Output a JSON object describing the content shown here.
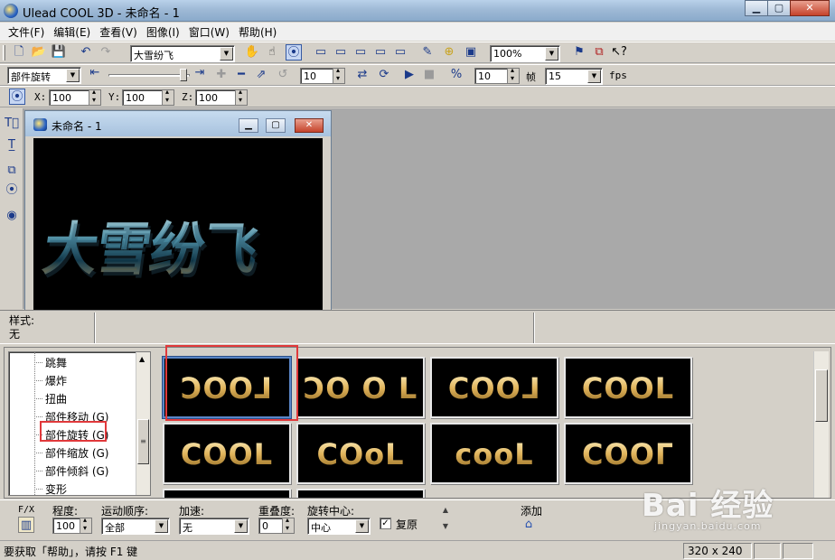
{
  "window": {
    "title": "Ulead COOL 3D - 未命名 - 1",
    "min_glyph": "▁",
    "max_glyph": "▢",
    "close_glyph": "✕"
  },
  "menu": [
    "文件(F)",
    "编辑(E)",
    "查看(V)",
    "图像(I)",
    "窗口(W)",
    "帮助(H)"
  ],
  "toolbar1": {
    "text_combo": "大雪纷飞",
    "zoom_combo": "100%"
  },
  "toolbar2": {
    "effect_combo": "部件旋转",
    "frame_value": "10",
    "step_value": "10",
    "frame_label": "帧",
    "fps_value": "15",
    "fps_label": "fps"
  },
  "toolbar3": {
    "x_label": "X:",
    "x_value": "100",
    "y_label": "Y:",
    "y_value": "100",
    "z_label": "Z:",
    "z_value": "100"
  },
  "doc_window": {
    "title": "未命名 - 1",
    "canvas_text": "大雪纷飞"
  },
  "style_row": {
    "label": "样式:",
    "value": "无"
  },
  "tree": {
    "items": [
      "跳舞",
      "爆炸",
      "扭曲",
      "部件移动 (G)",
      "部件旋转 (G)",
      "部件缩放 (G)",
      "部件倾斜 (G)",
      "变形"
    ],
    "selected_index": 4
  },
  "thumbnails": [
    {
      "text": "ƆOOᒧ"
    },
    {
      "text": "ꓛO O L"
    },
    {
      "text": "COO⅃"
    },
    {
      "text": "COOL"
    },
    {
      "text": "COOL"
    },
    {
      "text": "COoL"
    },
    {
      "text": "cooL"
    },
    {
      "text": "COOᒥ"
    }
  ],
  "props": {
    "fx_label": "F/X",
    "degree_label": "程度:",
    "degree_value": "100",
    "motion_label": "运动顺序:",
    "motion_value": "全部",
    "accel_label": "加速:",
    "accel_value": "无",
    "overlap_label": "重叠度:",
    "overlap_value": "0",
    "center_label": "旋转中心:",
    "center_value": "中心",
    "restore_label": "复原",
    "restore_checked": "✓",
    "add_label": "添加"
  },
  "status": {
    "help_text": "要获取「帮助」，请按 F1 键",
    "size_text": "320 x 240"
  },
  "watermark": {
    "main": "Bai 经验",
    "sub": "jingyan.baidu.com"
  },
  "colors": {
    "highlight": "#e0393b",
    "selection": "#5a86c6"
  }
}
